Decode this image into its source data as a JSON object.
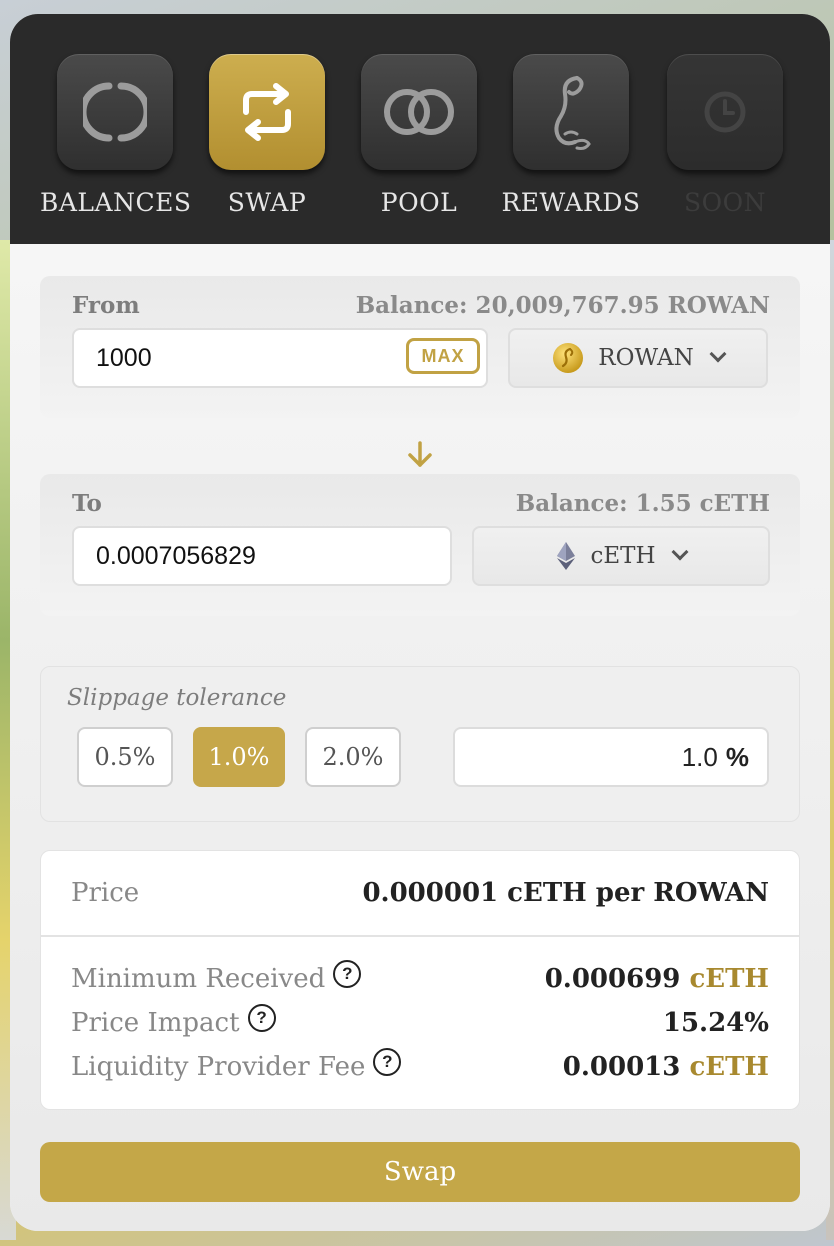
{
  "nav": {
    "items": [
      {
        "label": "BALANCES",
        "icon": "circle-brackets-icon",
        "active": false,
        "disabled": false
      },
      {
        "label": "SWAP",
        "icon": "swap-arrows-icon",
        "active": true,
        "disabled": false
      },
      {
        "label": "POOL",
        "icon": "overlapping-circles-icon",
        "active": false,
        "disabled": false
      },
      {
        "label": "REWARDS",
        "icon": "scroll-icon",
        "active": false,
        "disabled": false
      },
      {
        "label": "SOON",
        "icon": "clock-icon",
        "active": false,
        "disabled": true
      }
    ]
  },
  "from": {
    "label": "From",
    "balance": "Balance: 20,009,767.95 ROWAN",
    "amount": "1000",
    "max_label": "MAX",
    "token": "ROWAN"
  },
  "to": {
    "label": "To",
    "balance": "Balance: 1.55 cETH",
    "amount": "0.0007056829",
    "token": "cETH"
  },
  "slippage": {
    "label": "Slippage tolerance",
    "options": [
      "0.5%",
      "1.0%",
      "2.0%"
    ],
    "selected": "1.0%",
    "custom_value": "1.0",
    "custom_unit": "%"
  },
  "details": {
    "price_label": "Price",
    "price_value": "0.000001 cETH per ROWAN",
    "min_received_label": "Minimum Received",
    "min_received_value": "0.000699",
    "min_received_unit": "cETH",
    "price_impact_label": "Price Impact",
    "price_impact_value": "15.24%",
    "lp_fee_label": "Liquidity Provider Fee",
    "lp_fee_value": "0.00013",
    "lp_fee_unit": "cETH",
    "help_glyph": "?"
  },
  "swap_button": "Swap",
  "colors": {
    "accent": "#c4a748",
    "topbar": "#2a2a2a",
    "panel": "#f1f1f1"
  }
}
